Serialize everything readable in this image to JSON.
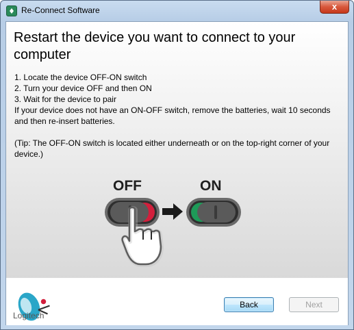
{
  "window": {
    "title": "Re-Connect Software",
    "close_glyph": "x"
  },
  "content": {
    "heading": "Restart the device you want to connect to your computer",
    "steps": [
      "1. Locate the device OFF-ON switch",
      "2. Turn your device OFF and then ON",
      "3. Wait for the device to pair"
    ],
    "note": "If your device does not have an ON-OFF switch, remove the batteries, wait 10 seconds and then re-insert batteries.",
    "tip": "(Tip: The OFF-ON switch is located either underneath or on the top-right corner of your device.)",
    "illustration": {
      "off_label": "OFF",
      "on_label": "ON",
      "colors": {
        "off_indicator": "#d21f3c",
        "on_indicator": "#1e9a58",
        "switch_body": "#4a4a4a"
      }
    }
  },
  "footer": {
    "logo_text": "Logitech",
    "back_label": "Back",
    "next_label": "Next"
  }
}
